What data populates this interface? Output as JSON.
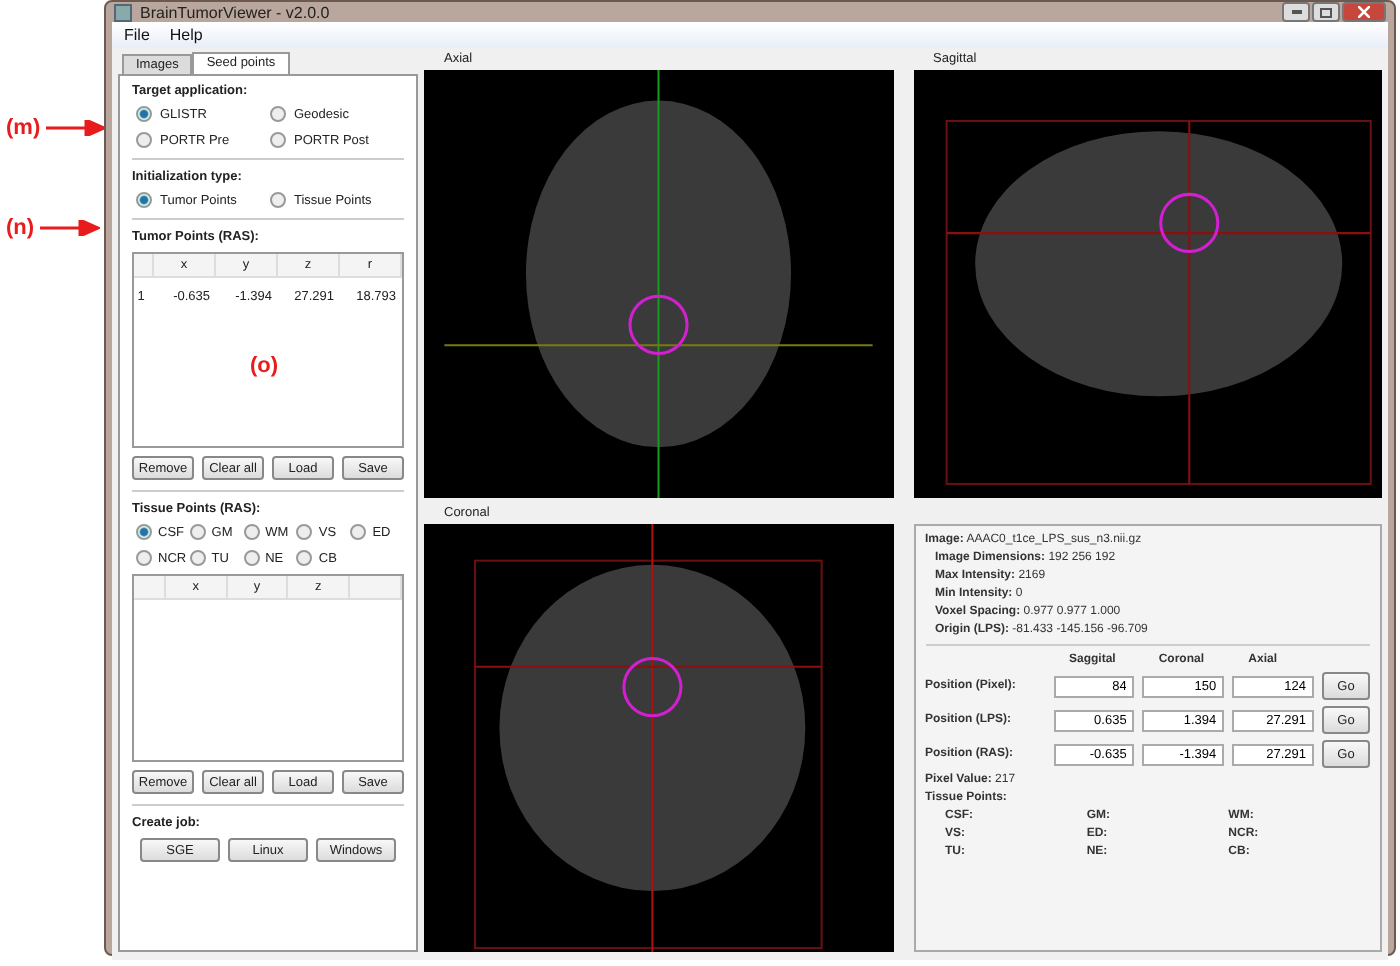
{
  "annotations": [
    {
      "label": "(m)",
      "kind": "arrow"
    },
    {
      "label": "(n)",
      "kind": "arrow"
    }
  ],
  "window": {
    "title": "BrainTumorViewer - v2.0.0"
  },
  "menu": [
    "File",
    "Help"
  ],
  "tabs": [
    {
      "label": "Images",
      "selected": false
    },
    {
      "label": "Seed points",
      "selected": true
    }
  ],
  "target_application": {
    "label": "Target application:",
    "options": [
      {
        "label": "GLISTR",
        "selected": true
      },
      {
        "label": "Geodesic",
        "selected": false
      },
      {
        "label": "PORTR Pre",
        "selected": false
      },
      {
        "label": "PORTR Post",
        "selected": false
      }
    ]
  },
  "initialization_type": {
    "label": "Initialization type:",
    "options": [
      {
        "label": "Tumor Points",
        "selected": true
      },
      {
        "label": "Tissue Points",
        "selected": false
      }
    ]
  },
  "tumor_points": {
    "label": "Tumor Points (RAS):",
    "columns": [
      "x",
      "y",
      "z",
      "r"
    ],
    "rows": [
      {
        "index": "1",
        "cells": [
          "-0.635",
          "-1.394",
          "27.291",
          "18.793"
        ]
      }
    ],
    "annotation": "(o)",
    "buttons": [
      "Remove",
      "Clear all",
      "Load",
      "Save"
    ]
  },
  "tissue_points": {
    "label": "Tissue Points (RAS):",
    "options": [
      {
        "label": "CSF",
        "selected": true
      },
      {
        "label": "GM",
        "selected": false
      },
      {
        "label": "WM",
        "selected": false
      },
      {
        "label": "VS",
        "selected": false
      },
      {
        "label": "ED",
        "selected": false
      },
      {
        "label": "NCR",
        "selected": false
      },
      {
        "label": "TU",
        "selected": false
      },
      {
        "label": "NE",
        "selected": false
      },
      {
        "label": "CB",
        "selected": false
      }
    ],
    "columns": [
      "x",
      "y",
      "z"
    ],
    "buttons": [
      "Remove",
      "Clear all",
      "Load",
      "Save"
    ]
  },
  "create_jobs": {
    "label": "Create job:",
    "buttons": [
      "SGE",
      "Linux",
      "Windows"
    ]
  },
  "views": [
    {
      "title": "Axial",
      "kind": "axial"
    },
    {
      "title": "Sagittal",
      "kind": "sagittal"
    },
    {
      "title": "Coronal",
      "kind": "coronal"
    }
  ],
  "info": {
    "image_label": "Image:",
    "image_value": "AAAC0_t1ce_LPS_sus_n3.nii.gz",
    "properties": [
      {
        "label": "Image Dimensions:",
        "value": "192 256 192"
      },
      {
        "label": "Max Intensity:",
        "value": "2169"
      },
      {
        "label": "Min Intensity:",
        "value": "0"
      },
      {
        "label": "Voxel Spacing:",
        "value": "0.977 0.977 1.000"
      },
      {
        "label": "Origin (LPS):",
        "value": "-81.433 -145.156 -96.709"
      }
    ],
    "columns": [
      "Saggital",
      "Coronal",
      "Axial"
    ],
    "positions": [
      {
        "label": "Position (Pixel):",
        "values": [
          "84",
          "150",
          "124"
        ],
        "button": "Go"
      },
      {
        "label": "Position (LPS):",
        "values": [
          "0.635",
          "1.394",
          "27.291"
        ],
        "button": "Go"
      },
      {
        "label": "Position (RAS):",
        "values": [
          "-0.635",
          "-1.394",
          "27.291"
        ],
        "button": "Go"
      }
    ],
    "pixel_value_label": "Pixel Value:",
    "pixel_value": "217",
    "tissue_points_label": "Tissue Points:",
    "tissues": [
      "CSF:",
      "GM:",
      "WM:",
      "VS:",
      "ED:",
      "NCR:",
      "TU:",
      "NE:",
      "CB:"
    ]
  }
}
